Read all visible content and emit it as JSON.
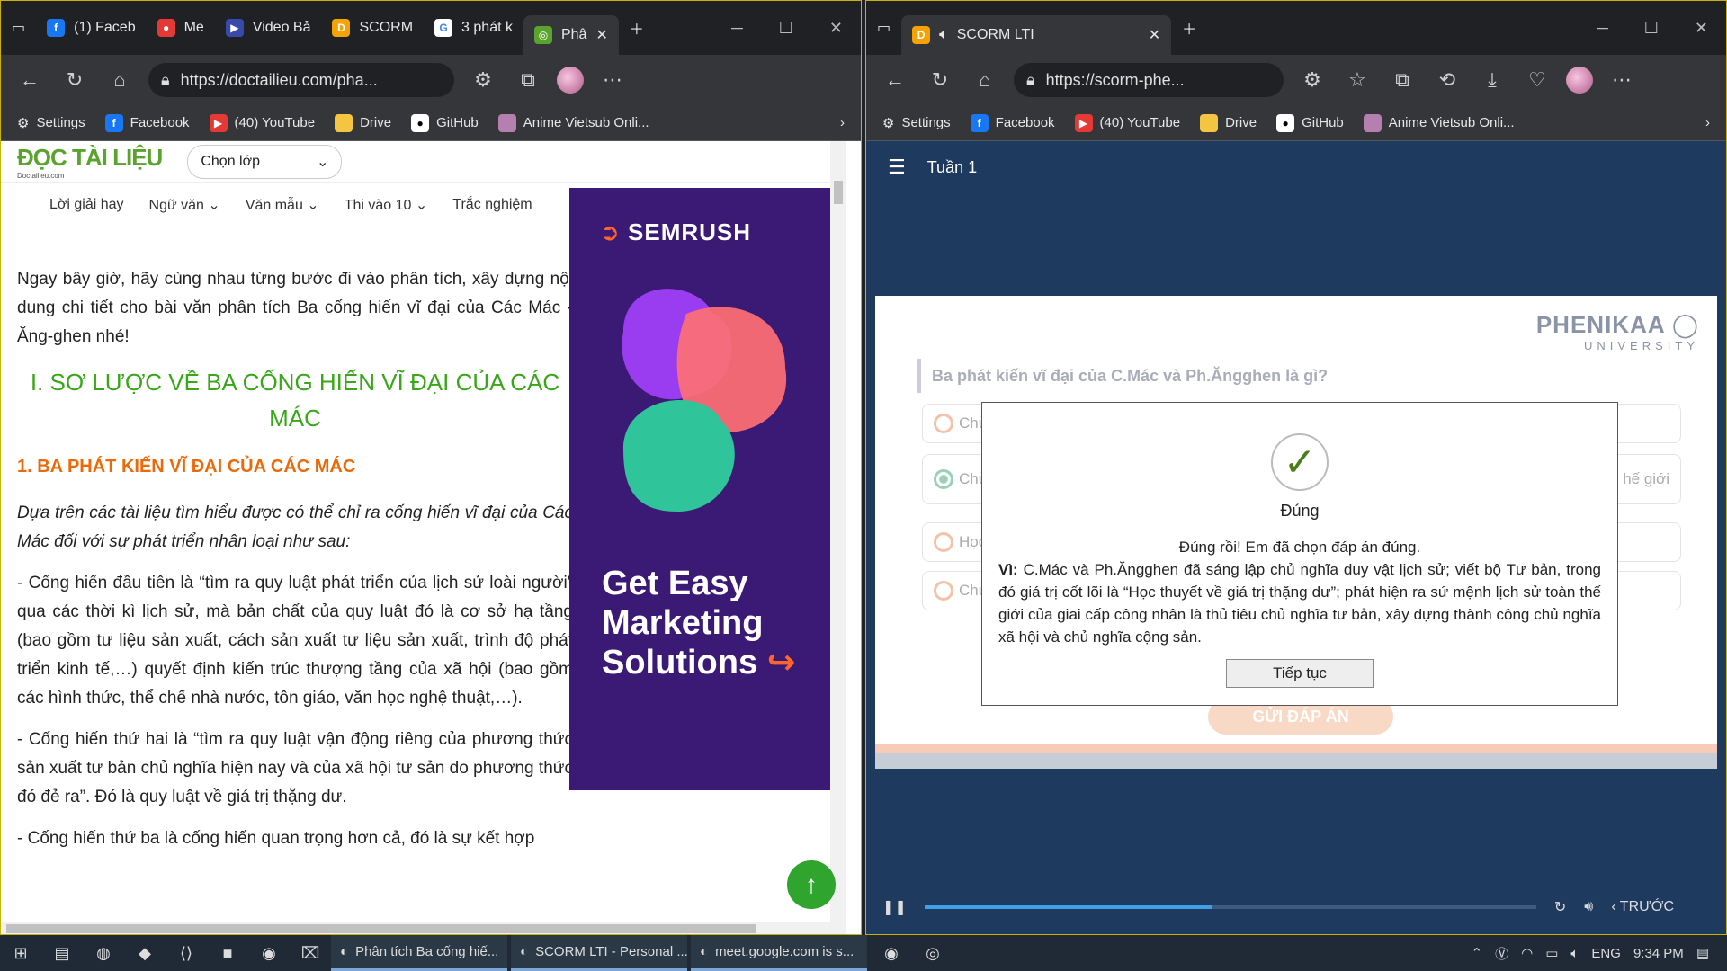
{
  "left_window": {
    "tabs": [
      {
        "label": "(1) Faceb",
        "icon": "facebook-icon",
        "color": "#1877f2"
      },
      {
        "label": "Me",
        "icon": "meet-icon",
        "color": "#e53935"
      },
      {
        "label": "Video Bả",
        "icon": "video-icon",
        "color": "#3949ab"
      },
      {
        "label": "SCORM",
        "icon": "scorm-d-icon",
        "color": "#f5a300"
      },
      {
        "label": "3 phát k",
        "icon": "google-icon",
        "color": "#4285f4"
      },
      {
        "label": "Phâ",
        "icon": "owl-icon",
        "color": "#5aa42e",
        "active": true
      }
    ],
    "url": "https://doctailieu.com/pha...",
    "bookmarks": [
      "Settings",
      "Facebook",
      "(40) YouTube",
      "Drive",
      "GitHub",
      "Anime Vietsub Onli..."
    ]
  },
  "left_page": {
    "logo": "ĐỌC TÀI LIỆU",
    "logo_sub": "Doctailieu.com",
    "select_label": "Chọn lớp",
    "menu": [
      "Lời giải hay",
      "Ngữ văn",
      "Văn mẫu",
      "Thi vào 10",
      "Trắc nghiệm"
    ],
    "intro": "Ngay bây giờ, hãy cùng nhau từng bước đi vào phân tích, xây dựng nội dung chi tiết cho bài văn phân tích Ba cống hiến vĩ đại của Các Mác - Ăng-ghen nhé!",
    "heading1": "I. SƠ LƯỢC VỀ BA CỐNG HIẾN VĨ ĐẠI CỦA CÁC MÁC",
    "heading2": "1. BA PHÁT KIẾN VĨ ĐẠI CỦA CÁC MÁC",
    "para1": "Dựa trên các tài liệu tìm hiểu được có thể chỉ ra cống hiến vĩ đại của Các Mác đối với sự phát triển nhân loại như sau:",
    "para2": "- Cống hiến đầu tiên là “tìm ra quy luật phát triển của lịch sử loài người” qua các thời kì lịch sử, mà bản chất của quy luật đó là cơ sở hạ tầng (bao gồm tư liệu sản xuất, cách sản xuất tư liệu sản xuất, trình độ phát triển kinh tế,…) quyết định kiến trúc thượng tầng của xã hội (bao gồm các hình thức, thể chế nhà nước, tôn giáo, văn học nghệ thuật,…).",
    "para3": "- Cống hiến thứ hai là “tìm ra quy luật vận động riêng của phương thức sản xuất tư bản chủ nghĩa hiện nay và của xã hội tư sản do phương thức đó đẻ ra”. Đó là quy luật về giá trị thặng dư.",
    "para4": "- Cống hiến thứ ba là cống hiến quan trọng hơn cả, đó là sự kết hợp",
    "ad_brand": "SEMRUSH",
    "ad_text": "Get Easy Marketing Solutions"
  },
  "right_window": {
    "tab_label": "SCORM LTI",
    "url": "https://scorm-phe...",
    "bookmarks": [
      "Settings",
      "Facebook",
      "(40) YouTube",
      "Drive",
      "GitHub",
      "Anime Vietsub Onli..."
    ]
  },
  "right_page": {
    "week": "Tuần 1",
    "brand": "PHENIKAA",
    "brand_sub": "UNIVERSITY",
    "question": "Ba phát kiến vĩ đại của C.Mác và Ph.Ăngghen là gì?",
    "options": [
      "Chủ",
      "Chủ của",
      "Học",
      "Chủ"
    ],
    "option2_tail": "hế giới",
    "submit": "GỬI ĐÁP ÁN",
    "modal_title": "Đúng",
    "modal_msg": "Đúng rồi! Em đã chọn đáp án đúng.",
    "modal_vi_label": "Vì:",
    "modal_explain": "C.Mác và Ph.Ăngghen đã sáng lập chủ nghĩa duy vật lịch sử; viết bộ Tư bản, trong đó giá trị cốt lõi là “Học thuyết về giá trị thặng dư”; phát hiện ra sứ mệnh lịch sử toàn thế giới của giai cấp công nhân là thủ tiêu chủ nghĩa tư bản, xây dựng thành công chủ nghĩa xã hội và chủ nghĩa cộng sản.",
    "modal_button": "Tiếp tục",
    "prev_label": "TRƯỚC",
    "progress": 0.47
  },
  "taskbar": {
    "apps": [
      "Phân tích Ba cống hiế...",
      "SCORM LTI - Personal ...",
      "meet.google.com is s..."
    ],
    "lang": "ENG",
    "time": "9:34 PM"
  }
}
